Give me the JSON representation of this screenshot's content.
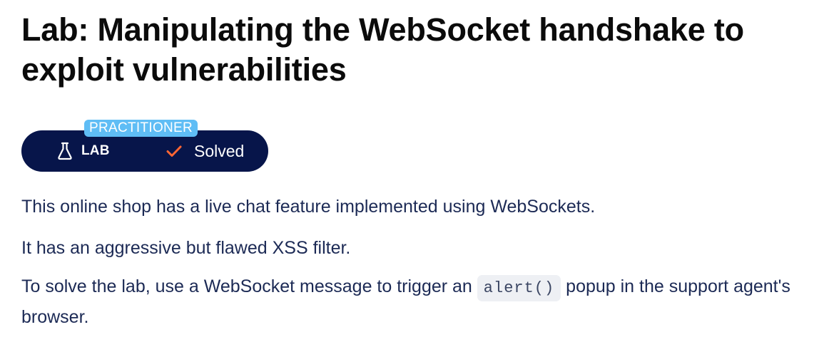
{
  "page_title": "Lab: Manipulating the WebSocket handshake to exploit vulnerabilities",
  "badge": {
    "level": "PRACTITIONER",
    "lab_label": "LAB",
    "status": "Solved",
    "colors": {
      "pill_bg": "#07154a",
      "level_bg": "#5fbdf5",
      "check": "#ff6633"
    }
  },
  "description": {
    "p1": "This online shop has a live chat feature implemented using WebSockets.",
    "p2": "It has an aggressive but flawed XSS filter.",
    "p3_before": "To solve the lab, use a WebSocket message to trigger an ",
    "p3_code": "alert()",
    "p3_after": " popup in the support agent's browser."
  }
}
